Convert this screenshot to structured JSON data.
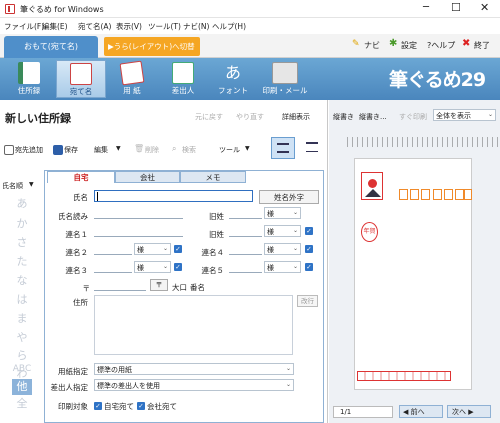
{
  "window": {
    "title": "筆ぐるめ for Windows"
  },
  "menu": [
    "ファイル(F)",
    "編集(E)",
    "宛て名(A)",
    "表示(V)",
    "ツール(T)",
    "ナビ(N)",
    "ヘルプ(H)"
  ],
  "modes": {
    "current": "おもて(宛て名)",
    "switch": "▶うら(レイアウト)へ切替"
  },
  "top_links": {
    "navi": "ナビ",
    "settings": "設定",
    "help": "?ヘルプ",
    "exit": "終了"
  },
  "ribbon": {
    "buttons": [
      "住所録",
      "宛て名",
      "用 紙",
      "差出人",
      "フォント",
      "印刷・メール"
    ],
    "logo": "筆ぐるめ29"
  },
  "address_book": {
    "title": "新しい住所録",
    "undo": "元に戻す",
    "redo": "やり直す",
    "details": "詳細表示",
    "toolbar": {
      "add": "宛先追加",
      "save": "保存",
      "edit": "編集",
      "delete": "削除",
      "search": "検索",
      "tools": "ツール"
    },
    "sort": "氏名順",
    "index": [
      "あ",
      "か",
      "さ",
      "た",
      "な",
      "は",
      "ま",
      "や",
      "ら",
      "わ",
      "ABC",
      "他",
      "全"
    ],
    "index_selected": "他"
  },
  "form": {
    "tabs": [
      "自宅",
      "会社",
      "メモ"
    ],
    "gaiji_button": "姓名外字",
    "labels": {
      "name": "氏名",
      "reading": "氏名読み",
      "joint1": "連名１",
      "joint2": "連名２",
      "joint3": "連名３",
      "old_surname": "旧姓",
      "joint4": "連名４",
      "joint5": "連名５",
      "postal": "〒",
      "postal_search": "〒",
      "ooaza": "大口",
      "street": "番名",
      "address": "住所",
      "linebreak": "改行",
      "paper": "用紙指定",
      "sender": "差出人指定",
      "print_target": "印刷対象"
    },
    "honorific": "様",
    "paper_value": "標準の用紙",
    "sender_value": "標準の差出人を使用",
    "print_home": "自宅宛て",
    "print_company": "会社宛て"
  },
  "preview": {
    "vertical1": "縦書き",
    "vertical2": "縦書き...",
    "apply": "すぐ印刷",
    "view": "全体を表示",
    "card_date": "平成",
    "card_year": "年賀",
    "page": "1/1",
    "prev": "前へ",
    "next": "次へ"
  }
}
